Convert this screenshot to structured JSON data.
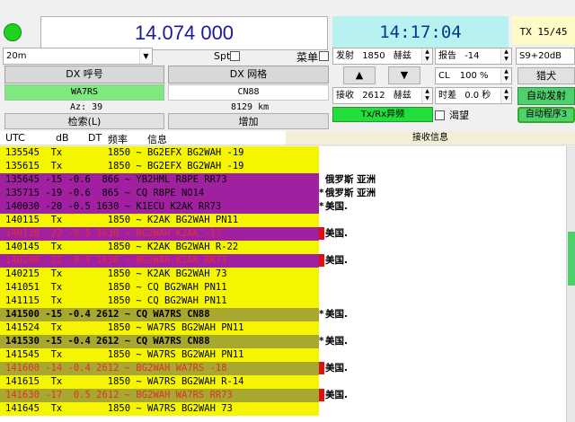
{
  "top": {
    "frequency": "14.074 000",
    "clock": "14:17:04",
    "tx_status": "TX 15/45",
    "band": "20m",
    "spot_label": "Spt",
    "menu_label": "菜单",
    "signal": "S9+20dB"
  },
  "controls": {
    "tx_label": "发射",
    "tx_value": "1850",
    "hz": "赫兹",
    "report_label": "报告",
    "report_value": "-14",
    "rx_label": "接收",
    "rx_value": "2612",
    "cl_label": "CL",
    "cl_value": "100 %",
    "offset_label": "时差",
    "offset_value": "0.0 秒",
    "up_arrow": "▲",
    "down_arrow": "▼",
    "hunt_button": "猎犬",
    "auto_tx_button": "自动发射",
    "auto_seq_button": "自动程序3",
    "split_button": "Tx/Rx异频",
    "hope_label": "渴望"
  },
  "dx": {
    "call_header": "DX 呼号",
    "grid_header": "DX 网格",
    "call_value": "WA7RS",
    "grid_value": "CN88",
    "az": "Az: 39",
    "dist": "8129 km",
    "lookup_button": "检索(L)",
    "add_button": "增加"
  },
  "table": {
    "col_utc": "UTC",
    "col_db": "dB",
    "col_dt": "DT",
    "col_freq": "频率",
    "col_msg": "信息",
    "right_header": "接收信息",
    "rows": [
      {
        "text": "135545  Tx        1850 ~ BG2EFX BG2WAH -19",
        "bg": "#f5f500",
        "fg": "#000",
        "mark": "",
        "note": ""
      },
      {
        "text": "135615  Tx        1850 ~ BG2EFX BG2WAH -19",
        "bg": "#f5f500",
        "fg": "#000",
        "mark": "",
        "note": ""
      },
      {
        "text": "135645 -15 -0.6  866 ~ YB2HML R8PE RR73",
        "bg": "#a020a0",
        "fg": "#000",
        "mark": "",
        "note": "俄罗斯 亚洲"
      },
      {
        "text": "135715 -19 -0.6  865 ~ CQ R8PE NO14",
        "bg": "#a020a0",
        "fg": "#000",
        "mark": "*",
        "note": "俄罗斯 亚洲"
      },
      {
        "text": "140030 -20 -0.5 1630 ~ K1ECU K2AK RR73",
        "bg": "#a020a0",
        "fg": "#000",
        "mark": "*",
        "note": "美国."
      },
      {
        "text": "140115  Tx        1850 ~ K2AK BG2WAH PN11",
        "bg": "#f5f500",
        "fg": "#000",
        "mark": "",
        "note": ""
      },
      {
        "text": "140130 -22 -0.5 1630 ~ BG2WAH K2AK -17",
        "bg": "#a020a0",
        "fg": "#e03030",
        "mark": "red",
        "note": "美国."
      },
      {
        "text": "140145  Tx        1850 ~ K2AK BG2WAH R-22",
        "bg": "#f5f500",
        "fg": "#000",
        "mark": "",
        "note": ""
      },
      {
        "text": "140200 -22 -0.5 1630 ~ BG2WAH K2AK RR73",
        "bg": "#a020a0",
        "fg": "#e03030",
        "mark": "red",
        "note": "美国."
      },
      {
        "text": "140215  Tx        1850 ~ K2AK BG2WAH 73",
        "bg": "#f5f500",
        "fg": "#000",
        "mark": "",
        "note": ""
      },
      {
        "text": "141051  Tx        1850 ~ CQ BG2WAH PN11",
        "bg": "#f5f500",
        "fg": "#000",
        "mark": "",
        "note": ""
      },
      {
        "text": "141115  Tx        1850 ~ CQ BG2WAH PN11",
        "bg": "#f5f500",
        "fg": "#000",
        "mark": "",
        "note": ""
      },
      {
        "text": "141500 -15 -0.4 2612 ~ CQ WA7RS CN88",
        "bg": "#a8a830",
        "fg": "#000",
        "mark": "*",
        "note": "美国.",
        "bold": true
      },
      {
        "text": "141524  Tx        1850 ~ WA7RS BG2WAH PN11",
        "bg": "#f5f500",
        "fg": "#000",
        "mark": "",
        "note": ""
      },
      {
        "text": "141530 -15 -0.4 2612 ~ CQ WA7RS CN88",
        "bg": "#a8a830",
        "fg": "#000",
        "mark": "*",
        "note": "美国.",
        "bold": true
      },
      {
        "text": "141545  Tx        1850 ~ WA7RS BG2WAH PN11",
        "bg": "#f5f500",
        "fg": "#000",
        "mark": "",
        "note": ""
      },
      {
        "text": "141600 -14 -0.4 2612 ~ BG2WAH WA7RS -18",
        "bg": "#a8a830",
        "fg": "#e03030",
        "mark": "red",
        "note": "美国."
      },
      {
        "text": "141615  Tx        1850 ~ WA7RS BG2WAH R-14",
        "bg": "#f5f500",
        "fg": "#000",
        "mark": "",
        "note": ""
      },
      {
        "text": "141630 -17  0.5 2612 ~ BG2WAH WA7RS RR73",
        "bg": "#a8a830",
        "fg": "#e03030",
        "mark": "red",
        "note": "美国."
      },
      {
        "text": "141645  Tx        1850 ~ WA7RS BG2WAH 73",
        "bg": "#f5f500",
        "fg": "#000",
        "mark": "",
        "note": ""
      }
    ]
  }
}
